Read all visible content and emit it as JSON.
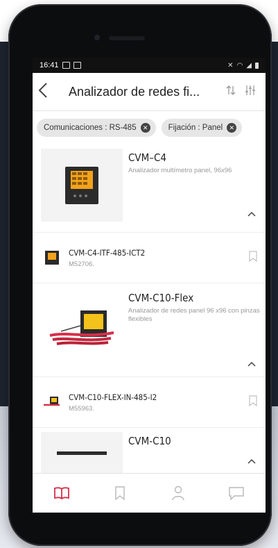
{
  "status_bar": {
    "time": "16:41"
  },
  "header": {
    "title": "Analizador de redes fi...",
    "back_icon": "back-arrow-icon",
    "sort_icon": "sort-icon",
    "filter_icon": "filter-sliders-icon"
  },
  "filters": [
    {
      "label": "Comunicaciones : RS-485"
    },
    {
      "label": "Fijación : Panel"
    }
  ],
  "products": [
    {
      "name": "CVM–C4",
      "description": "Analizador multímetro panel, 96x96",
      "variant": {
        "code": "CVM-C4-ITF-485-ICT2",
        "ref": "M52706."
      }
    },
    {
      "name": "CVM-C10-Flex",
      "description": "Analizador de redes panel 96 x96 con pinzas flexibles",
      "variant": {
        "code": "CVM-C10-FLEX-IN-485-I2",
        "ref": "M55963."
      }
    },
    {
      "name": "CVM-C10",
      "description": ""
    }
  ],
  "colors": {
    "accent": "#d6304a",
    "icon_gray": "#b8b8b8"
  }
}
